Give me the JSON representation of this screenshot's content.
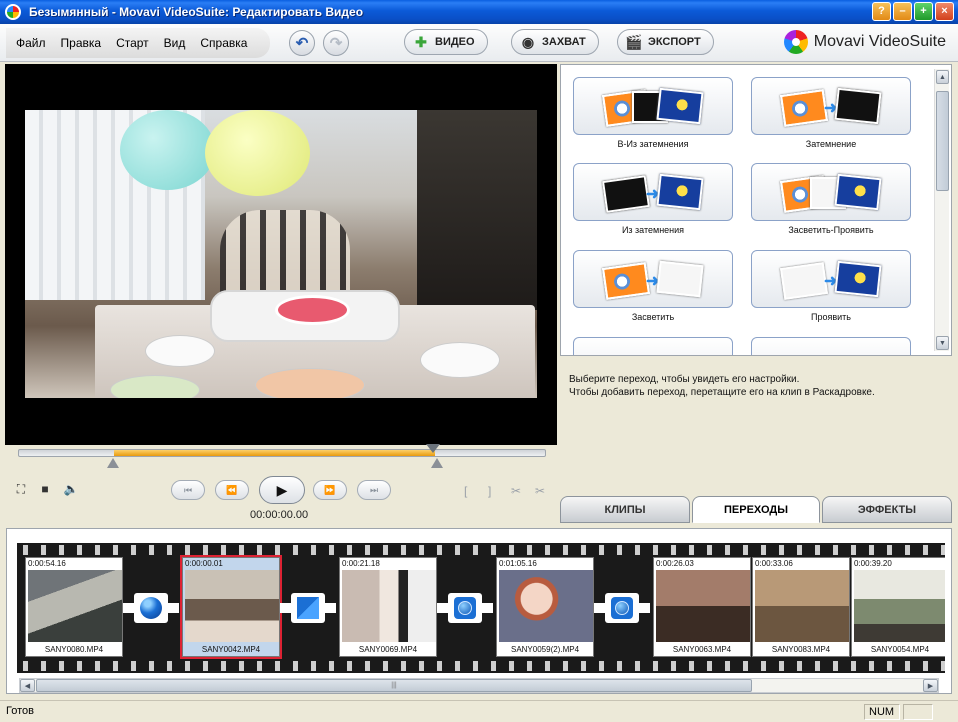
{
  "window": {
    "title": "Безымянный - Movavi VideoSuite: Редактировать Видео",
    "buttons": [
      "?",
      "–",
      "+",
      "×"
    ]
  },
  "menu": [
    "Файл",
    "Правка",
    "Старт",
    "Вид",
    "Справка"
  ],
  "toolbar": {
    "undo": "↶",
    "redo": "↷",
    "video_label": "ВИДЕО",
    "capture_label": "ЗАХВАТ",
    "export_label": "ЭКСПОРТ",
    "brand": "Movavi VideoSuite"
  },
  "player": {
    "timecode": "00:00:00.00",
    "buttons": {
      "start": "⏮",
      "rewind": "⏪",
      "play": "▶",
      "forward": "⏩",
      "end": "⏭"
    },
    "left_icons": [
      "⛶",
      "■",
      "🔈"
    ],
    "right_icons": [
      "[",
      "]",
      "✂",
      "✂"
    ],
    "selection_fill": 0.61
  },
  "transitions": {
    "items": [
      {
        "label": "В-Из затемнения",
        "a": "flower",
        "b": "night",
        "mid": "black"
      },
      {
        "label": "Затемнение",
        "a": "flower",
        "b": "black"
      },
      {
        "label": "Из затемнения",
        "a": "black",
        "b": "night"
      },
      {
        "label": "Засветить-Проявить",
        "a": "flower",
        "b": "night",
        "mid": "white"
      },
      {
        "label": "Засветить",
        "a": "flower",
        "b": "white"
      },
      {
        "label": "Проявить",
        "a": "white",
        "b": "night"
      }
    ],
    "hint_line1": "Выберите переход, чтобы увидеть его настройки.",
    "hint_line2": "Чтобы добавить переход, перетащите его на клип в Раскадровке."
  },
  "tabs": [
    "КЛИПЫ",
    "ПЕРЕХОДЫ",
    "ЭФФЕКТЫ"
  ],
  "active_tab": 1,
  "storyboard": {
    "clips": [
      {
        "duration": "0:00:54.16",
        "name": "SANY0080.MP4"
      },
      {
        "duration": "0:00:00.01",
        "name": "SANY0042.MP4",
        "selected": true
      },
      {
        "duration": "0:00:21.18",
        "name": "SANY0069.MP4"
      },
      {
        "duration": "0:01:05.16",
        "name": "SANY0059(2).MP4"
      },
      {
        "duration": "0:00:26.03",
        "name": "SANY0063.MP4"
      },
      {
        "duration": "0:00:33.06",
        "name": "SANY0083.MP4"
      },
      {
        "duration": "0:00:39.20",
        "name": "SANY0054.MP4"
      }
    ],
    "scroll_grip": "|||"
  },
  "status": {
    "text": "Готов",
    "num": "NUM"
  },
  "colors": {
    "titlebar": "#0b5ad8",
    "seek_selection": "#e89b0e",
    "transition_blue": "#1b6fd4",
    "selected_clip_border": "#d22233"
  }
}
